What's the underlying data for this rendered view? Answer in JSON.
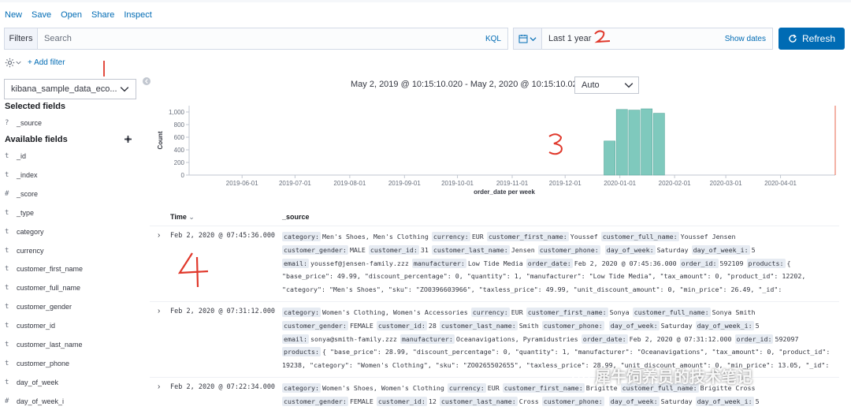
{
  "topmenu": {
    "items": [
      "New",
      "Save",
      "Open",
      "Share",
      "Inspect"
    ]
  },
  "querybar": {
    "filters_label": "Filters",
    "search_placeholder": "Search",
    "kql_label": "KQL",
    "date_range": "Last 1 year",
    "show_dates": "Show dates",
    "refresh": "Refresh",
    "accent": "#006bb4"
  },
  "filterbar": {
    "add_filter": "+ Add filter"
  },
  "sidebar": {
    "index_pattern": "kibana_sample_data_eco...",
    "selected_title": "Selected fields",
    "selected_fields": [
      {
        "type": "?",
        "name": "_source"
      }
    ],
    "available_title": "Available fields",
    "available_fields": [
      {
        "type": "t",
        "name": "_id"
      },
      {
        "type": "t",
        "name": "_index"
      },
      {
        "type": "#",
        "name": "_score"
      },
      {
        "type": "t",
        "name": "_type"
      },
      {
        "type": "t",
        "name": "category"
      },
      {
        "type": "t",
        "name": "currency"
      },
      {
        "type": "t",
        "name": "customer_first_name"
      },
      {
        "type": "t",
        "name": "customer_full_name"
      },
      {
        "type": "t",
        "name": "customer_gender"
      },
      {
        "type": "t",
        "name": "customer_id"
      },
      {
        "type": "t",
        "name": "customer_last_name"
      },
      {
        "type": "t",
        "name": "customer_phone"
      },
      {
        "type": "t",
        "name": "day_of_week"
      },
      {
        "type": "#",
        "name": "day_of_week_i"
      }
    ]
  },
  "main": {
    "range_text": "May 2, 2019 @ 10:15:10.020 - May 2, 2020 @ 10:15:10.020 —",
    "interval": "Auto"
  },
  "chart_data": {
    "type": "bar",
    "ylabel": "Count",
    "xlabel": "order_date per week",
    "ylim": [
      0,
      1100
    ],
    "yticks": [
      0,
      200,
      400,
      600,
      800,
      1000
    ],
    "ytick_labels": [
      "0",
      "200",
      "400",
      "600",
      "800",
      "1,000"
    ],
    "xticks": [
      "2019-06-01",
      "2019-07-01",
      "2019-08-01",
      "2019-09-01",
      "2019-10-01",
      "2019-11-01",
      "2019-12-01",
      "2020-01-01",
      "2020-02-01",
      "2020-03-01",
      "2020-04-01"
    ],
    "bars": [
      {
        "x": "2019-12-23",
        "value": 540
      },
      {
        "x": "2019-12-30",
        "value": 1040
      },
      {
        "x": "2020-01-06",
        "value": 1030
      },
      {
        "x": "2020-01-13",
        "value": 1050
      },
      {
        "x": "2020-01-20",
        "value": 980
      }
    ],
    "bar_color": "#7fc9bd",
    "x_start": "2019-05-02",
    "x_end": "2020-05-02",
    "grid": false
  },
  "table": {
    "time_header": "Time",
    "source_header": "_source",
    "rows": [
      {
        "time": "Feb 2, 2020 @ 07:45:36.000",
        "lines": [
          [
            [
              "category:",
              "Men's Shoes, Men's Clothing"
            ],
            [
              "currency:",
              "EUR"
            ],
            [
              "customer_first_name:",
              "Youssef"
            ],
            [
              "customer_full_name:",
              "Youssef Jensen"
            ]
          ],
          [
            [
              "customer_gender:",
              "MALE"
            ],
            [
              "customer_id:",
              "31"
            ],
            [
              "customer_last_name:",
              "Jensen"
            ],
            [
              "customer_phone:",
              ""
            ],
            [
              "day_of_week:",
              "Saturday"
            ],
            [
              "day_of_week_i:",
              "5"
            ]
          ],
          [
            [
              "email:",
              "youssef@jensen-family.zzz"
            ],
            [
              "manufacturer:",
              "Low Tide Media"
            ],
            [
              "order_date:",
              "Feb 2, 2020 @ 07:45:36.000"
            ],
            [
              "order_id:",
              "592109"
            ],
            [
              "products:",
              "{"
            ]
          ],
          [
            [
              "",
              "\"base_price\": 49.99, \"discount_percentage\": 0, \"quantity\": 1, \"manufacturer\": \"Low Tide Media\", \"tax_amount\": 0, \"product_id\": 12202,"
            ]
          ],
          [
            [
              "",
              "\"category\": \"Men's Shoes\", \"sku\": \"ZO0396603966\", \"taxless_price\": 49.99, \"unit_discount_amount\": 0, \"min_price\": 26.49, \"_id\":"
            ]
          ]
        ]
      },
      {
        "time": "Feb 2, 2020 @ 07:31:12.000",
        "lines": [
          [
            [
              "category:",
              "Women's Clothing, Women's Accessories"
            ],
            [
              "currency:",
              "EUR"
            ],
            [
              "customer_first_name:",
              "Sonya"
            ],
            [
              "customer_full_name:",
              "Sonya Smith"
            ]
          ],
          [
            [
              "customer_gender:",
              "FEMALE"
            ],
            [
              "customer_id:",
              "28"
            ],
            [
              "customer_last_name:",
              "Smith"
            ],
            [
              "customer_phone:",
              ""
            ],
            [
              "day_of_week:",
              "Saturday"
            ],
            [
              "day_of_week_i:",
              "5"
            ]
          ],
          [
            [
              "email:",
              "sonya@smith-family.zzz"
            ],
            [
              "manufacturer:",
              "Oceanavigations, Pyramidustries"
            ],
            [
              "order_date:",
              "Feb 2, 2020 @ 07:31:12.000"
            ],
            [
              "order_id:",
              "592097"
            ]
          ],
          [
            [
              "products:",
              "{ \"base_price\": 28.99, \"discount_percentage\": 0, \"quantity\": 1, \"manufacturer\": \"Oceanavigations\", \"tax_amount\": 0, \"product_id\":"
            ]
          ],
          [
            [
              "",
              "19238, \"category\": \"Women's Clothing\", \"sku\": \"ZO0265502655\", \"taxless_price\": 28.99, \"unit_discount_amount\": 0, \"min_price\": 13.05, \"_id\":"
            ]
          ]
        ]
      },
      {
        "time": "Feb 2, 2020 @ 07:22:34.000",
        "lines": [
          [
            [
              "category:",
              "Women's Shoes, Women's Clothing"
            ],
            [
              "currency:",
              "EUR"
            ],
            [
              "customer_first_name:",
              "Brigitte"
            ],
            [
              "customer_full_name:",
              "Brigitte Cross"
            ]
          ],
          [
            [
              "customer_gender:",
              "FEMALE"
            ],
            [
              "customer_id:",
              "12"
            ],
            [
              "customer_last_name:",
              "Cross"
            ],
            [
              "customer_phone:",
              ""
            ],
            [
              "day_of_week:",
              "Saturday"
            ],
            [
              "day_of_week_i:",
              "5"
            ]
          ]
        ]
      }
    ]
  },
  "annotations": [
    "1",
    "2",
    "3",
    "4"
  ],
  "annotation_color": "#e0382b",
  "watermark": "犀牛饲养员的技术笔记"
}
